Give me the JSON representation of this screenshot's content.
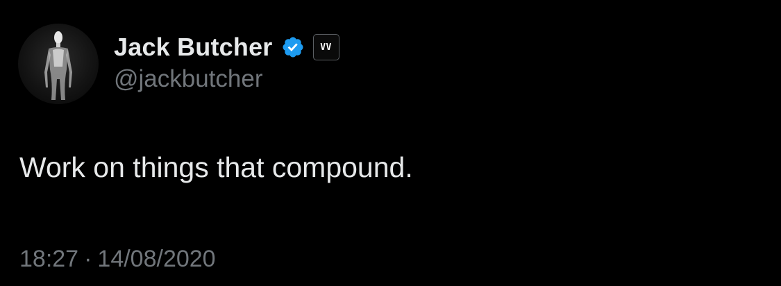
{
  "author": {
    "display_name": "Jack Butcher",
    "handle": "@jackbutcher",
    "avatar_icon": "silhouette-avatar",
    "verified_icon": "verified-badge-icon",
    "verified_color": "#1d9bf0",
    "affiliate_badge": "VV"
  },
  "tweet": {
    "text": "Work on things that compound.",
    "time": "18:27",
    "separator": "·",
    "date": "14/08/2020"
  },
  "colors": {
    "background": "#000000",
    "primary_text": "#e7e9ea",
    "secondary_text": "#71767b"
  }
}
